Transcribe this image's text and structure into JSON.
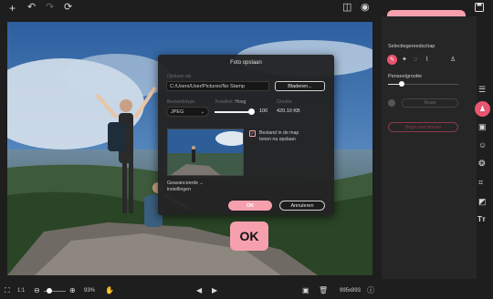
{
  "toolbar": {
    "new_icon": "plus-icon",
    "undo_icon": "undo-icon",
    "redo_icon": "redo-icon",
    "reset_icon": "reset-icon",
    "compare_icon": "compare-icon",
    "preview_icon": "eye-icon",
    "save_icon": "floppy-icon"
  },
  "callouts": {
    "diskette": "Diskette",
    "ok": "OK"
  },
  "dialog": {
    "title": "Foto opslaan",
    "save_in_label": "Opslaan als",
    "path_value": "C:/Users/User/Pictures/No Stamp",
    "browse_label": "Bladeren...",
    "file_type_label": "Bestandstype",
    "file_type_value": "JPEG",
    "quality_label": "Kwaliteit:",
    "quality_level": "Hoog",
    "quality_value": "100",
    "quality_fraction": 1.0,
    "size_label": "Grootte",
    "size_value": "420.10 KB",
    "checkbox_label_1": "Bestand in de map",
    "checkbox_label_2": "tonen na opslaan",
    "advanced_label_1": "Geavanceerde",
    "advanced_label_2": "instellingen",
    "ok_label": "OK",
    "cancel_label": "Annuleren"
  },
  "rightpanel": {
    "selection_label": "Selectiegereedschap",
    "brush_size_label": "Penseelgrootte",
    "brush_size_fraction": 0.2,
    "reset_label": "Reset",
    "clear_label": "Begin met wissen"
  },
  "bottombar": {
    "ratio": "1:1",
    "zoom": "93%",
    "dimensions": "995x893"
  },
  "colors": {
    "accent": "#f6a0ae",
    "active_tool": "#e8566e"
  }
}
